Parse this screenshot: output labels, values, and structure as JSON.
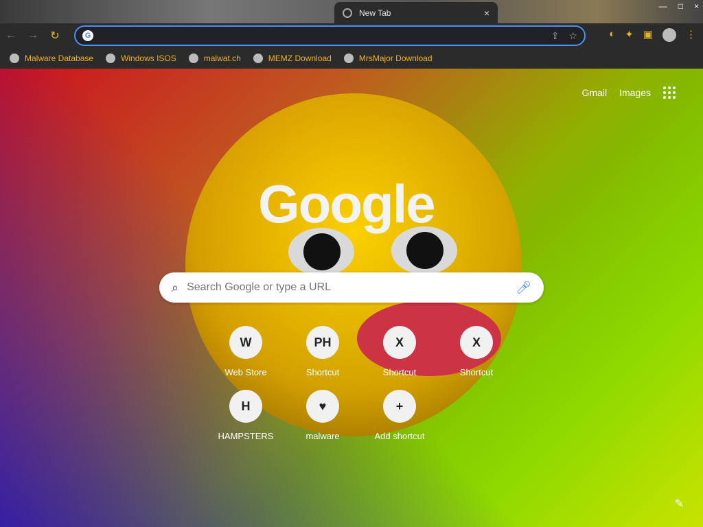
{
  "browser": {
    "tab_title": "New Tab",
    "omnibox_value": "",
    "bookmarks": [
      "Malware Database",
      "Windows ISOS",
      "malwat.ch",
      "MEMZ Download",
      "MrsMajor Download"
    ]
  },
  "page": {
    "top_links": [
      "Gmail",
      "Images"
    ],
    "logo": "Google",
    "search_placeholder": "Search Google or type a URL",
    "shortcuts": [
      {
        "label": "Web Store",
        "icon": "W"
      },
      {
        "label": "Shortcut",
        "icon": "PH"
      },
      {
        "label": "Shortcut",
        "icon": "X"
      },
      {
        "label": "Shortcut",
        "icon": "X"
      },
      {
        "label": "HAMPSTERS",
        "icon": "H"
      },
      {
        "label": "malware",
        "icon": "♥"
      },
      {
        "label": "Add shortcut",
        "icon": "+"
      }
    ]
  }
}
